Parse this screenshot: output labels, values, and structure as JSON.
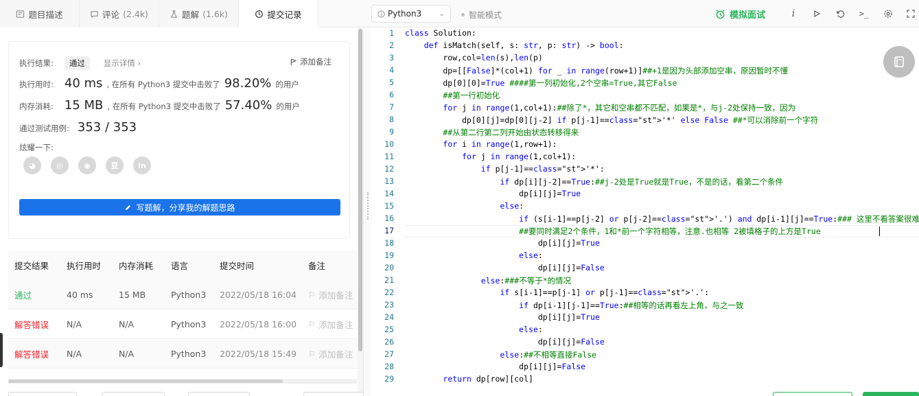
{
  "tabs": [
    {
      "label": "题目描述",
      "count": "",
      "icon": "description-icon"
    },
    {
      "label": "评论",
      "count": "(2.4k)",
      "icon": "comment-icon"
    },
    {
      "label": "题解",
      "count": "(1.6k)",
      "icon": "flask-icon"
    },
    {
      "label": "提交记录",
      "count": "",
      "icon": "history-icon"
    }
  ],
  "toolbar": {
    "language": "Python3",
    "smart_mode": "智能模式",
    "mock_interview": "模拟面试",
    "accent": "#2db55d"
  },
  "result": {
    "label": "执行结果:",
    "status": "通过",
    "detail_link": "显示详情 ›",
    "add_note": "添加备注",
    "runtime_label": "执行用时:",
    "runtime_value": "40 ms",
    "runtime_desc": ", 在所有 Python3 提交中击败了",
    "runtime_pct": "98.20%",
    "runtime_suffix": "的用户",
    "memory_label": "内存消耗:",
    "memory_value": "15 MB",
    "memory_desc": ", 在所有 Python3 提交中击败了",
    "memory_pct": "57.40%",
    "memory_suffix": "的用户",
    "tests_label": "通过测试用例:",
    "tests_value": "353 / 353",
    "share_label": "炫耀一下:",
    "share_icons": [
      "wechat-icon",
      "weibo-icon",
      "qq-icon",
      "douban-icon",
      "linkedin-icon"
    ],
    "share_glyphs": [
      "◕",
      "◎",
      "◉",
      "豆",
      "in"
    ],
    "write_button": "写题解，分享我的解题思路"
  },
  "submissions": {
    "headers": [
      "提交结果",
      "执行用时",
      "内存消耗",
      "语言",
      "提交时间",
      "备注"
    ],
    "rows": [
      {
        "status": "通过",
        "kind": "ok",
        "runtime": "40 ms",
        "memory": "15 MB",
        "lang": "Python3",
        "time": "2022/05/18 16:04",
        "note": "添加备注"
      },
      {
        "status": "解答错误",
        "kind": "err",
        "runtime": "N/A",
        "memory": "N/A",
        "lang": "Python3",
        "time": "2022/05/18 16:00",
        "note": "添加备注"
      },
      {
        "status": "解答错误",
        "kind": "err",
        "runtime": "N/A",
        "memory": "N/A",
        "lang": "Python3",
        "time": "2022/05/18 15:49",
        "note": "添加备注"
      }
    ]
  },
  "editor": {
    "current_line": 17,
    "lines": [
      "class Solution:",
      "    def isMatch(self, s: str, p: str) -> bool:",
      "        row,col=len(s),len(p)",
      "        dp=[[False]*(col+1) for _ in range(row+1)]##+1是因为头部添加空串，原因暂时不懂",
      "        dp[0][0]=True ####第一列初始化,2个空串=True,其它False",
      "        ##第一行初始化",
      "        for j in range(1,col+1):##除了*，其它和空串都不匹配，如果是*，与j-2处保持一致，因为",
      "            dp[0][j]=dp[0][j-2] if p[j-1]=='*' else False ##*可以消除前一个字符",
      "        ##从第二行第二列开始由状态转移得来",
      "        for i in range(1,row+1):",
      "            for j in range(1,col+1):",
      "                if p[j-1]=='*':",
      "                    if dp[i][j-2]==True:##j-2处是True就是True，不是的话，看第二个条件",
      "                        dp[i][j]=True",
      "                    else:",
      "                        if (s[i-1]==p[j-2] or p[j-2]=='.') and dp[i-1][j]==True:### 这里不看答案很难想",
      "                        ##要同时满足2个条件，1和*前一个字符相等，注意.也相等 2被填格子的上方是True",
      "                            dp[i][j]=True",
      "                        else:",
      "                            dp[i][j]=False",
      "                else:###不等于*的情况",
      "                    if s[i-1]==p[j-1] or p[j-1]=='.':",
      "                        if dp[i-1][j-1]==True:##相等的话再看左上角，与之一致",
      "                            dp[i][j]=True",
      "                        else:",
      "                            dp[i][j]=False",
      "                    else:##不相等直接False",
      "                        dp[i][j]=False",
      "        return dp[row][col]"
    ]
  }
}
